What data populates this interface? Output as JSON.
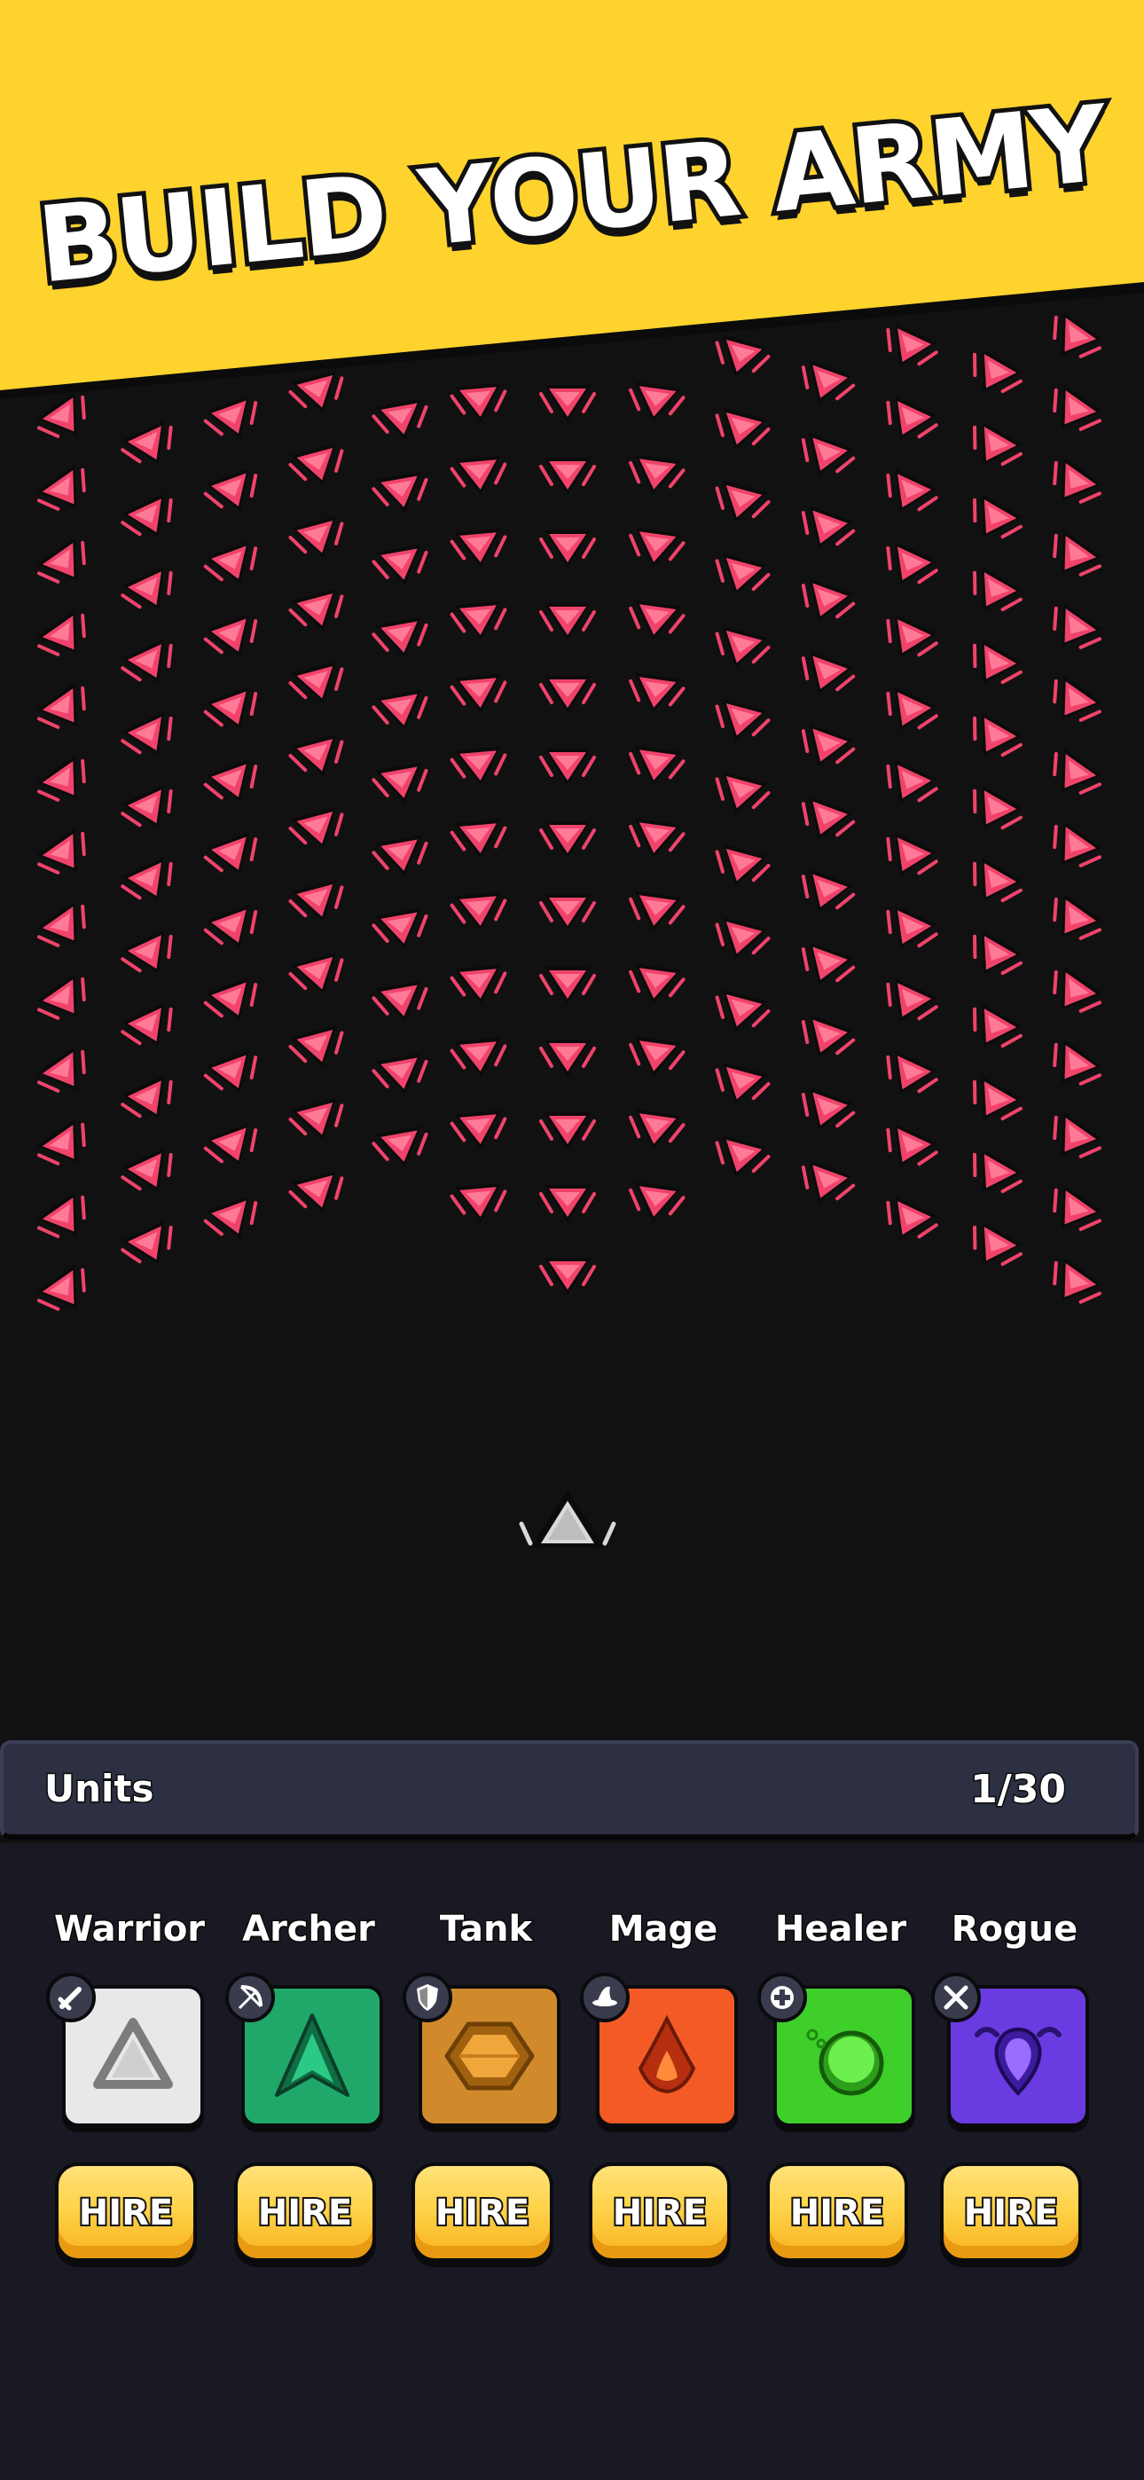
{
  "banner": {
    "title": "BUILD YOUR ARMY",
    "background_color": "#ffd32e"
  },
  "battlefield": {
    "enemy_color": "#f0436b",
    "player_unit": "warrior-triangle-icon",
    "player_color": "#d9d9d9"
  },
  "units_bar": {
    "label": "Units",
    "count": "1/30"
  },
  "units": [
    {
      "name": "Warrior",
      "hire_label": "HIRE",
      "badge_icon": "sword-icon",
      "card_color": "#e8e8ea",
      "unit_icon": "warrior-triangle-icon"
    },
    {
      "name": "Archer",
      "hire_label": "HIRE",
      "badge_icon": "bow-icon",
      "card_color": "#1fa86a",
      "unit_icon": "archer-arrow-icon"
    },
    {
      "name": "Tank",
      "hire_label": "HIRE",
      "badge_icon": "shield-icon",
      "card_color": "#d08a2c",
      "unit_icon": "tank-hexagon-icon"
    },
    {
      "name": "Mage",
      "hire_label": "HIRE",
      "badge_icon": "wizard-hat-icon",
      "card_color": "#f45a26",
      "unit_icon": "mage-flame-icon"
    },
    {
      "name": "Healer",
      "hire_label": "HIRE",
      "badge_icon": "heal-plus-icon",
      "card_color": "#3ecf2a",
      "unit_icon": "healer-orb-icon"
    },
    {
      "name": "Rogue",
      "hire_label": "HIRE",
      "badge_icon": "crossed-daggers-icon",
      "card_color": "#6a3be0",
      "unit_icon": "rogue-drop-icon"
    }
  ]
}
